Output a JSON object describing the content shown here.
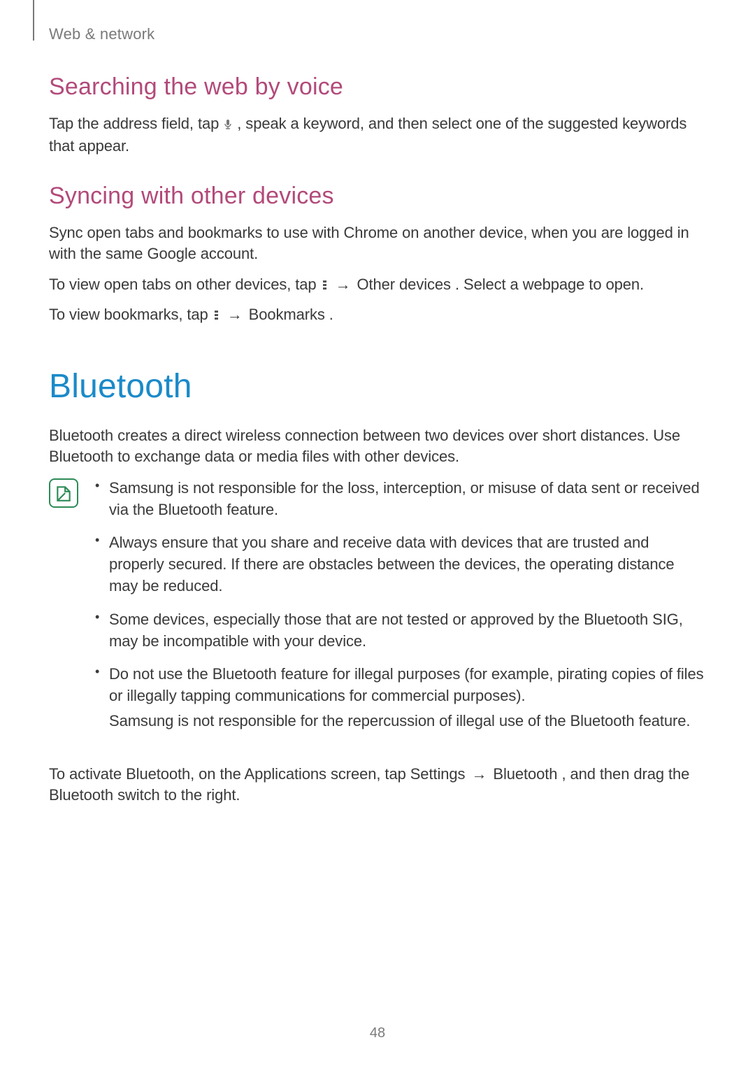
{
  "breadcrumb": "Web & network",
  "section1": {
    "heading": "Searching the web by voice",
    "para_a": "Tap the address field, tap ",
    "para_b": " , speak a keyword, and then select one of the suggested keywords that appear."
  },
  "section2": {
    "heading": "Syncing with other devices",
    "para1": "Sync open tabs and bookmarks to use with Chrome on another device, when you are logged in with the same Google account.",
    "para2_a": "To view open tabs on other devices, tap ",
    "para2_arrow": " → ",
    "para2_b": "Other devices",
    "para2_c": ". Select a webpage to open.",
    "para3_a": "To view bookmarks, tap ",
    "para3_arrow": " → ",
    "para3_b": "Bookmarks",
    "para3_c": "."
  },
  "bluetooth": {
    "heading": "Bluetooth",
    "intro": "Bluetooth creates a direct wireless connection between two devices over short distances. Use Bluetooth to exchange data or media files with other devices.",
    "notes": [
      "Samsung is not responsible for the loss, interception, or misuse of data sent or received via the Bluetooth feature.",
      "Always ensure that you share and receive data with devices that are trusted and properly secured. If there are obstacles between the devices, the operating distance may be reduced.",
      "Some devices, especially those that are not tested or approved by the Bluetooth SIG, may be incompatible with your device."
    ],
    "note4_a": "Do not use the Bluetooth feature for illegal purposes (for example, pirating copies of files or illegally tapping communications for commercial purposes).",
    "note4_b": "Samsung is not responsible for the repercussion of illegal use of the Bluetooth feature.",
    "activate_a": "To activate Bluetooth, on the Applications screen, tap ",
    "activate_b": "Settings",
    "activate_arrow": " → ",
    "activate_c": "Bluetooth",
    "activate_d": ", and then drag the ",
    "activate_e": "Bluetooth",
    "activate_f": " switch to the right."
  },
  "pagenum": "48"
}
